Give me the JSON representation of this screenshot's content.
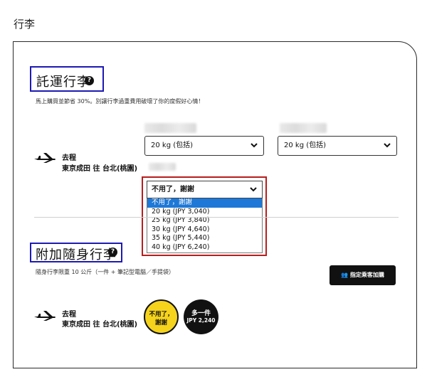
{
  "page": {
    "heading": "行李"
  },
  "checked_baggage": {
    "title": "託運行李",
    "help_icon": "question-mark-icon",
    "promo": "馬上購買並節省 30%。別讓行李過重費用破壞了你的度假好心情！",
    "flight": {
      "direction": "去程",
      "route": "東京成田 往 台北(桃園)"
    },
    "passenger_select_1": {
      "value": "20 kg (包括)"
    },
    "passenger_select_2": {
      "value": "20 kg (包括)"
    },
    "extra_dropdown": {
      "selected": "不用了，謝謝",
      "options": [
        "不用了，謝謝",
        "20 kg (JPY 3,040)",
        "25 kg (JPY 3,840)",
        "30 kg (JPY 4,640)",
        "35 kg (JPY 5,440)",
        "40 kg (JPY 6,240)"
      ]
    }
  },
  "carry_on": {
    "title": "附加隨身行李",
    "help_icon": "question-mark-icon",
    "note": "隨身行李限重 10 公斤（一件 + 筆記型電腦／手提袋）",
    "assign_button": "指定乘客加購",
    "flight": {
      "direction": "去程",
      "route": "東京成田 往 台北(桃園)"
    },
    "option_no": {
      "line1": "不用了，",
      "line2": "謝謝"
    },
    "option_add": {
      "line1": "多一件",
      "line2": "JPY 2,240"
    }
  },
  "colors": {
    "highlight_blue": "#1d1ab3",
    "highlight_red": "#b81d1d",
    "selected_blue": "#1e78d7",
    "yellow": "#f5d31c"
  }
}
